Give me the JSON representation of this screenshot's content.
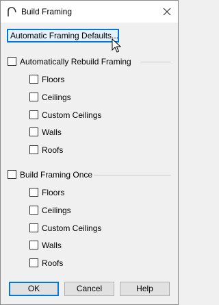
{
  "window": {
    "title": "Build Framing",
    "close_label": "Close"
  },
  "defaults_button": "Automatic Framing Defaults...",
  "group_auto": {
    "label": "Automatically Rebuild Framing",
    "checked": false,
    "items": [
      "Floors",
      "Ceilings",
      "Custom Ceilings",
      "Walls",
      "Roofs"
    ]
  },
  "group_once": {
    "label": "Build Framing Once",
    "checked": false,
    "items": [
      "Floors",
      "Ceilings",
      "Custom Ceilings",
      "Walls",
      "Roofs"
    ]
  },
  "buttons": {
    "ok": "OK",
    "cancel": "Cancel",
    "help": "Help"
  }
}
